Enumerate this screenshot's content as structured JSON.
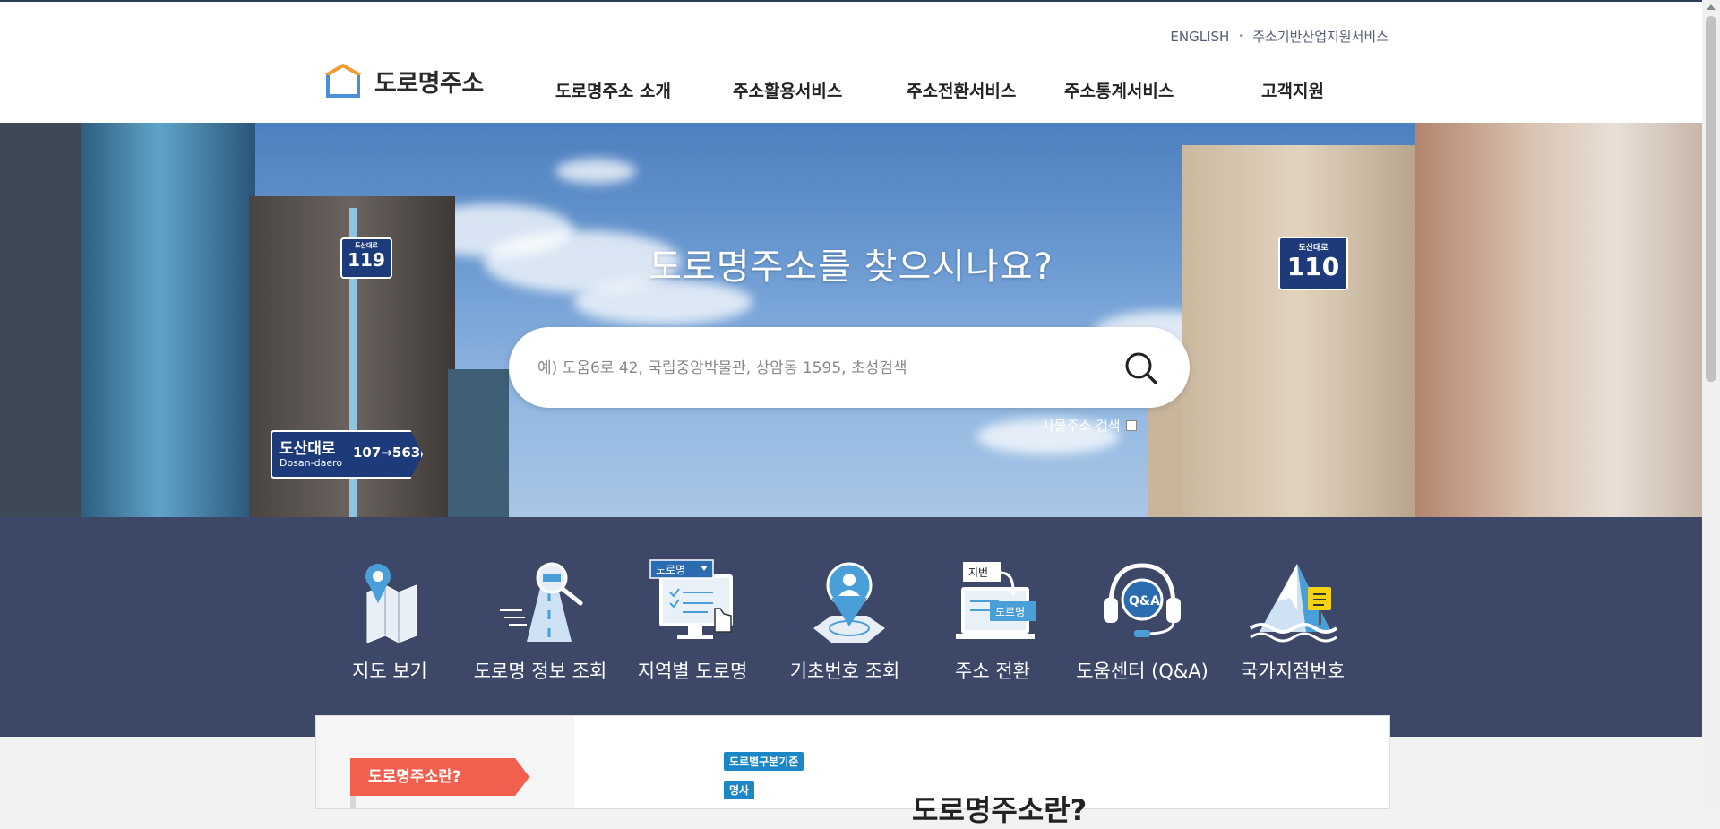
{
  "header": {
    "util_links": [
      "ENGLISH",
      "주소기반산업지원서비스"
    ],
    "logo_text": "도로명주소",
    "nav": [
      "도로명주소 소개",
      "주소활용서비스",
      "주소전환서비스",
      "주소통계서비스",
      "고객지원"
    ]
  },
  "hero": {
    "title": "도로명주소를 찾으시나요?",
    "search_placeholder": "예) 도움6로 42, 국립중앙박물관, 상암동 1595, 초성검색",
    "thing_address_label": "사물주소 검색",
    "thing_address_checked": false,
    "signs": {
      "left_top_small": "도산대로",
      "left_top_number": "119",
      "right_top_small": "도산대로",
      "right_top_number": "110",
      "road_name": "도산대로",
      "road_roman": "Dosan-daero",
      "road_number": "107→563"
    }
  },
  "quick_menu": [
    {
      "label": "지도 보기",
      "icon": "map-pin-icon"
    },
    {
      "label": "도로명 정보 조회",
      "icon": "road-search-icon"
    },
    {
      "label": "지역별 도로명",
      "icon": "road-select-monitor-icon",
      "icon_text": "도로명"
    },
    {
      "label": "기초번호 조회",
      "icon": "location-person-icon"
    },
    {
      "label": "주소 전환",
      "icon": "address-convert-icon",
      "icon_text_top": "지번",
      "icon_text_bottom": "도로명"
    },
    {
      "label": "도움센터 (Q&A)",
      "icon": "headset-qa-icon",
      "icon_text": "Q&A"
    },
    {
      "label": "국가지점번호",
      "icon": "mountain-marker-icon"
    }
  ],
  "content": {
    "side_tab": "도로명주소란?",
    "tag_1": "도로별구분기준",
    "tag_2": "명사",
    "title": "도로명주소란?"
  },
  "colors": {
    "nav_dark": "#2e385c",
    "accent_red": "#f15f4f",
    "sign_blue": "#1d3a7a",
    "tag_blue": "#1b87c6",
    "logo_blue": "#4a90d9",
    "logo_orange": "#f39c34"
  }
}
